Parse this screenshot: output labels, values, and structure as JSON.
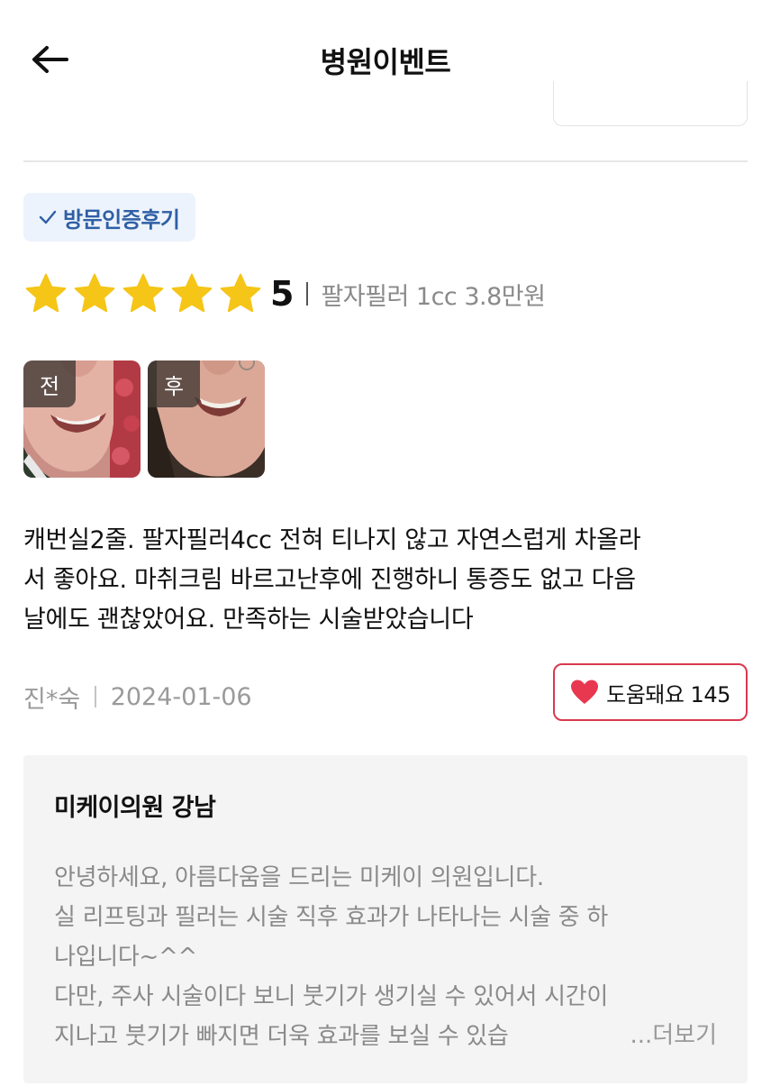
{
  "header": {
    "title": "병원이벤트"
  },
  "review": {
    "badge_label": "방문인증후기",
    "rating": 5,
    "rating_label": "5",
    "treatment": "팔자필러 1cc 3.8만원",
    "photos": [
      {
        "tag": "전"
      },
      {
        "tag": "후"
      }
    ],
    "text": "캐번실2줄. 팔자필러4cc 전혀 티나지 않고 자연스럽게 차올라서 좋아요. 마취크림 바르고난후에 진행하니 통증도 없고 다음날에도 괜찮았어요. 만족하는 시술받았습니다",
    "text_lines": [
      "캐번실2줄. 팔자필러4cc 전혀 티나지 않고 자연스럽게 차올라",
      "서 좋아요. 마취크림 바르고난후에 진행하니 통증도 없고 다음",
      "날에도 괜찮았어요. 만족하는 시술받았습니다"
    ],
    "author": "진*숙",
    "date": "2024-01-06",
    "helpful_label": "도움돼요 145"
  },
  "reply": {
    "clinic_name": "미케이의원 강남",
    "lines": [
      "안녕하세요, 아름다움을 드리는 미케이 의원입니다.",
      "실 리프팅과 필러는 시술 직후 효과가 나타나는 시술 중 하",
      "나입니다~^^",
      "다만, 주사 시술이다 보니 붓기가 생기실 수 있어서 시간이",
      "지나고 붓기가 빠지면 더욱 효과를 보실 수 있습"
    ],
    "more_label": "...더보기"
  },
  "colors": {
    "star": "#F5C518",
    "badge_text": "#2F5FA5",
    "badge_bg": "#EDF3FC",
    "heart": "#E8384F",
    "helpful_border": "#D8394F",
    "reply_bg": "#F4F4F4"
  },
  "icons": {
    "back": "arrow-left-icon",
    "badge": "check-icon",
    "star": "star-icon",
    "helpful": "heart-icon"
  }
}
